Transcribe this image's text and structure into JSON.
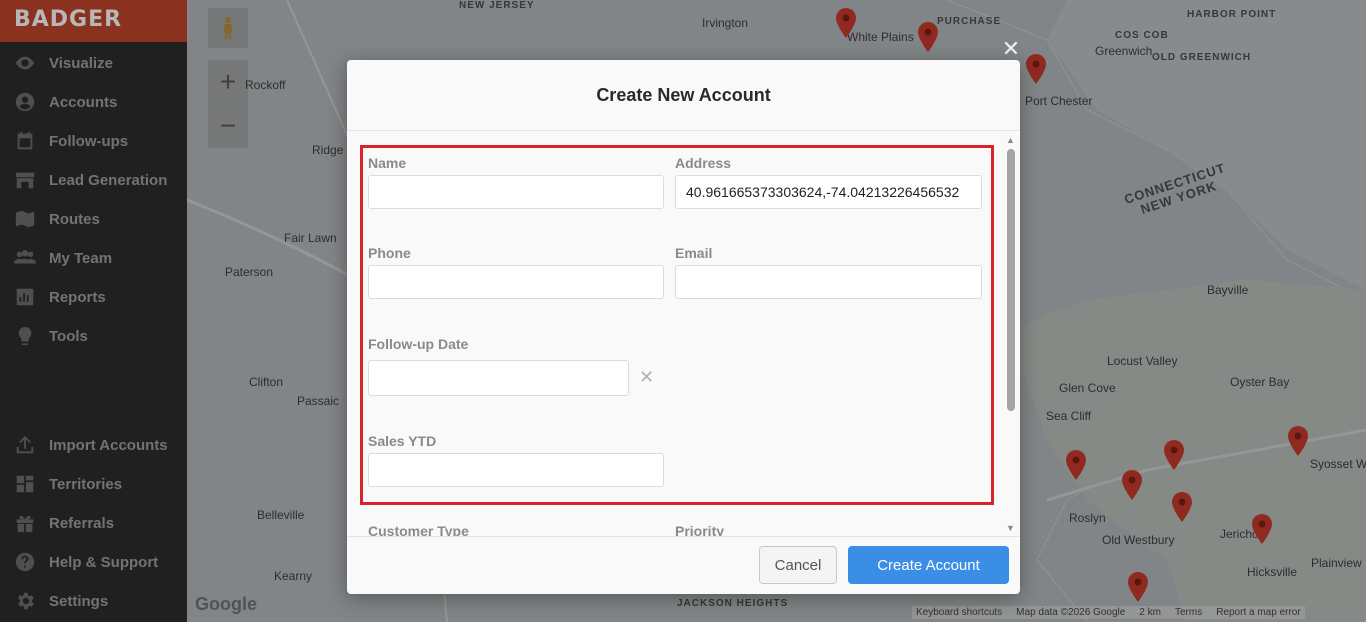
{
  "app": {
    "logo_text": "BADGER"
  },
  "sidebar": {
    "items": [
      {
        "label": "Visualize",
        "icon": "eye-icon"
      },
      {
        "label": "Accounts",
        "icon": "user-circle-icon"
      },
      {
        "label": "Follow-ups",
        "icon": "calendar-icon"
      },
      {
        "label": "Lead Generation",
        "icon": "store-icon"
      },
      {
        "label": "Routes",
        "icon": "map-icon"
      },
      {
        "label": "My Team",
        "icon": "team-icon"
      },
      {
        "label": "Reports",
        "icon": "chart-icon"
      },
      {
        "label": "Tools",
        "icon": "lightbulb-icon"
      },
      {
        "label": "Import Accounts",
        "icon": "upload-icon"
      },
      {
        "label": "Territories",
        "icon": "grid-icon"
      },
      {
        "label": "Referrals",
        "icon": "gift-icon"
      },
      {
        "label": "Help & Support",
        "icon": "question-icon"
      },
      {
        "label": "Settings",
        "icon": "gear-icon"
      }
    ]
  },
  "map": {
    "labels": [
      "Irvington",
      "White Plains",
      "PURCHASE",
      "HARBOR POINT",
      "COS COB",
      "Greenwich",
      "OLD GREENWICH",
      "Port Chester",
      "Ridge",
      "Fair Lawn",
      "Paterson",
      "Clifton",
      "Passaic",
      "Belleville",
      "Kearny",
      "CONNECTICUT",
      "NEW YORK",
      "Bayville",
      "Locust Valley",
      "Oyster Bay",
      "Glen Cove",
      "Sea Cliff",
      "Syosset",
      "Woodbury",
      "Roslyn",
      "Old Westbury",
      "Jericho",
      "Plainview",
      "Hicksville",
      "JACKSON HEIGHTS",
      "NEW JERSEY",
      "Rockoff"
    ],
    "google_logo": "Google",
    "footer": [
      "Keyboard shortcuts",
      "Map data ©2026 Google",
      "2 km",
      "Terms",
      "Report a map error"
    ],
    "zoom_in": "+",
    "zoom_out": "−"
  },
  "modal": {
    "title": "Create New Account",
    "close_glyph": "✕",
    "fields": {
      "name": {
        "label": "Name",
        "value": ""
      },
      "address": {
        "label": "Address",
        "value": "40.961665373303624,-74.04213226456532"
      },
      "phone": {
        "label": "Phone",
        "value": ""
      },
      "email": {
        "label": "Email",
        "value": ""
      },
      "followup": {
        "label": "Follow-up Date",
        "value": "",
        "clear_glyph": "✕"
      },
      "sales": {
        "label": "Sales YTD",
        "value": ""
      },
      "customer_type": {
        "label": "Customer Type"
      },
      "priority": {
        "label": "Priority"
      }
    },
    "buttons": {
      "cancel": "Cancel",
      "create": "Create Account"
    }
  },
  "colors": {
    "highlight": "#d9232b",
    "primary": "#3a8ee6",
    "logo_bg": "#b8432a",
    "pin": "#c0392b"
  }
}
